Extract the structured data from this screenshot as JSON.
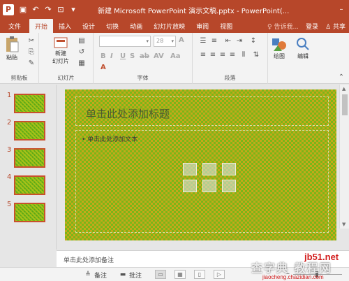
{
  "titlebar": {
    "title": "新建 Microsoft PowerPoint 演示文稿.pptx - PowerPoint(...",
    "logo": "P"
  },
  "tabs": [
    "文件",
    "开始",
    "插入",
    "设计",
    "切换",
    "动画",
    "幻灯片放映",
    "审阅",
    "视图"
  ],
  "tabs_right": {
    "tell": "♀ 告诉我...",
    "login": "登录",
    "share": "♙ 共享"
  },
  "ribbon": {
    "paste": "粘贴",
    "clipboard": "剪贴板",
    "new_slide": "新建\n幻灯片",
    "slides_group": "幻灯片",
    "font_size": "28",
    "font_group": "字体",
    "paragraph_group": "段落",
    "drawing": "绘图",
    "editing": "编辑"
  },
  "thumbnails": [
    "1",
    "2",
    "3",
    "4",
    "5"
  ],
  "slide": {
    "title_placeholder": "单击此处添加标题",
    "body_placeholder": "• 单击此处添加文本"
  },
  "notes": {
    "placeholder": "单击此处添加备注"
  },
  "statusbar": {
    "notes": "备注",
    "comments": "批注"
  },
  "watermark": {
    "site": "jb51.net",
    "brand": "查字典 教程网",
    "url": "jiaocheng.chazidian.com"
  }
}
